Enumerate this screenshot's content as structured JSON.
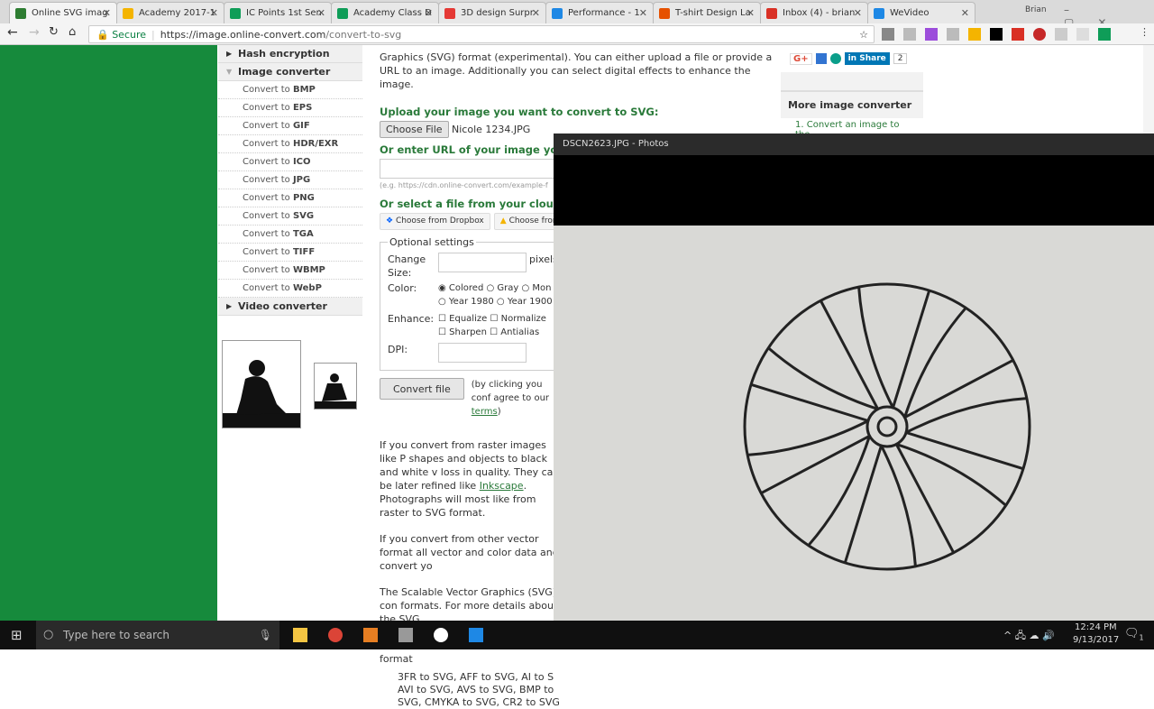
{
  "browser": {
    "tabs": [
      {
        "title": "Online SVG imag",
        "color": "#2e7d32"
      },
      {
        "title": "Academy 2017-1",
        "color": "#f4b400"
      },
      {
        "title": "IC Points 1st Sen",
        "color": "#0f9d58"
      },
      {
        "title": "Academy Class D",
        "color": "#0f9d58"
      },
      {
        "title": "3D design Surpr",
        "color": "#e53935"
      },
      {
        "title": "Performance - 1",
        "color": "#1e88e5"
      },
      {
        "title": "T-shirt Design La",
        "color": "#e65100"
      },
      {
        "title": "Inbox (4) - brian",
        "color": "#d93025"
      },
      {
        "title": "WeVideo",
        "color": "#1e88e5"
      }
    ],
    "profile": "Brian",
    "secure_label": "Secure",
    "url_host": "https://image.online-convert.com",
    "url_path": "/convert-to-svg"
  },
  "sidebar": {
    "sections": [
      {
        "label": "Hash encryption"
      },
      {
        "label": "Image converter"
      },
      {
        "label": "Video converter"
      }
    ],
    "prefix": "Convert to",
    "items": [
      "BMP",
      "EPS",
      "GIF",
      "HDR/EXR",
      "ICO",
      "JPG",
      "PNG",
      "SVG",
      "TGA",
      "TIFF",
      "WBMP",
      "WebP"
    ]
  },
  "main": {
    "intro": "Graphics (SVG) format (experimental). You can either upload a file or provide a URL to an image. Additionally you can select digital effects to enhance the image.",
    "upload_heading": "Upload your image you want to convert to SVG:",
    "choose_file": "Choose File",
    "file_name": "Nicole 1234.JPG",
    "url_heading": "Or enter URL of your image you want to convert to SVG:",
    "url_example": "(e.g. https://cdn.online-convert.com/example-f",
    "cloud_heading": "Or select a file from your cloud s",
    "dropbox": "Choose from Dropbox",
    "gdrive": "Choose from",
    "optional": "Optional settings",
    "change_size": "Change Size:",
    "pixels": "pixels",
    "color_label": "Color:",
    "color_options": [
      "Colored",
      "Gray",
      "Mon",
      "Year 1980",
      "Year 1900"
    ],
    "enhance_label": "Enhance:",
    "enhance_options": [
      "Equalize",
      "Normalize",
      "Sharpen",
      "Antialias"
    ],
    "dpi_label": "DPI:",
    "convert": "Convert file",
    "terms_text": "(by clicking you conf agree to our",
    "terms_link": "terms",
    "p1a": "If you convert from raster images like P shapes and objects to black and white v loss in quality. They can be later refined like",
    "inkscape": "Inkscape",
    "p1b": ". Photographs will most like from raster to SVG format.",
    "p2": "If you convert from other vector format all vector and color data and convert yo",
    "p3": "The Scalable Vector Graphics (SVG) con formats. For more details about the SVG",
    "p4": "Here is a list of some conversion format",
    "formats1": "3FR to SVG, AFF to SVG, AI to S",
    "formats2": "AVI to SVG, AVS to SVG, BMP to",
    "formats3": "SVG, CMYKA to SVG, CR2 to SVG"
  },
  "right": {
    "share": "Share",
    "share_count": "2",
    "more_heading": "More image converter",
    "more_item": "1. Convert an image to the"
  },
  "photos": {
    "title": "DSCN2623.JPG - Photos"
  },
  "taskbar": {
    "search": "Type here to search",
    "time": "12:24 PM",
    "date": "9/13/2017",
    "notif": "1"
  }
}
